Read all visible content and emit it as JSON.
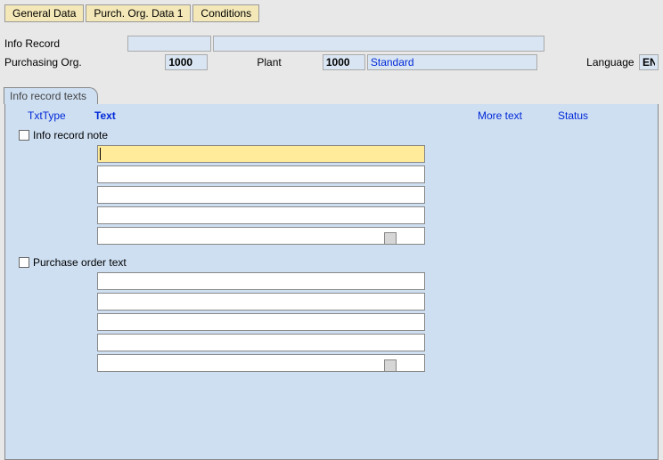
{
  "tabs": {
    "general": "General Data",
    "purch_org": "Purch. Org. Data 1",
    "conditions": "Conditions"
  },
  "header": {
    "info_record_label": "Info Record",
    "info_record_value": "",
    "info_record_desc": "",
    "purch_org_label": "Purchasing Org.",
    "purch_org_value": "1000",
    "plant_label": "Plant",
    "plant_value": "1000",
    "plant_desc": "Standard",
    "language_label": "Language",
    "language_value": "EN"
  },
  "panel": {
    "tab_label": "Info record texts",
    "columns": {
      "txttype": "TxtType",
      "text": "Text",
      "more": "More text",
      "status": "Status"
    },
    "sections": [
      {
        "title": "Info record note",
        "step": "1",
        "lines": [
          "",
          "",
          "",
          "",
          ""
        ],
        "active_line": 0
      },
      {
        "title": "Purchase order text",
        "step": "2",
        "lines": [
          "",
          "",
          "",
          "",
          ""
        ]
      }
    ]
  }
}
